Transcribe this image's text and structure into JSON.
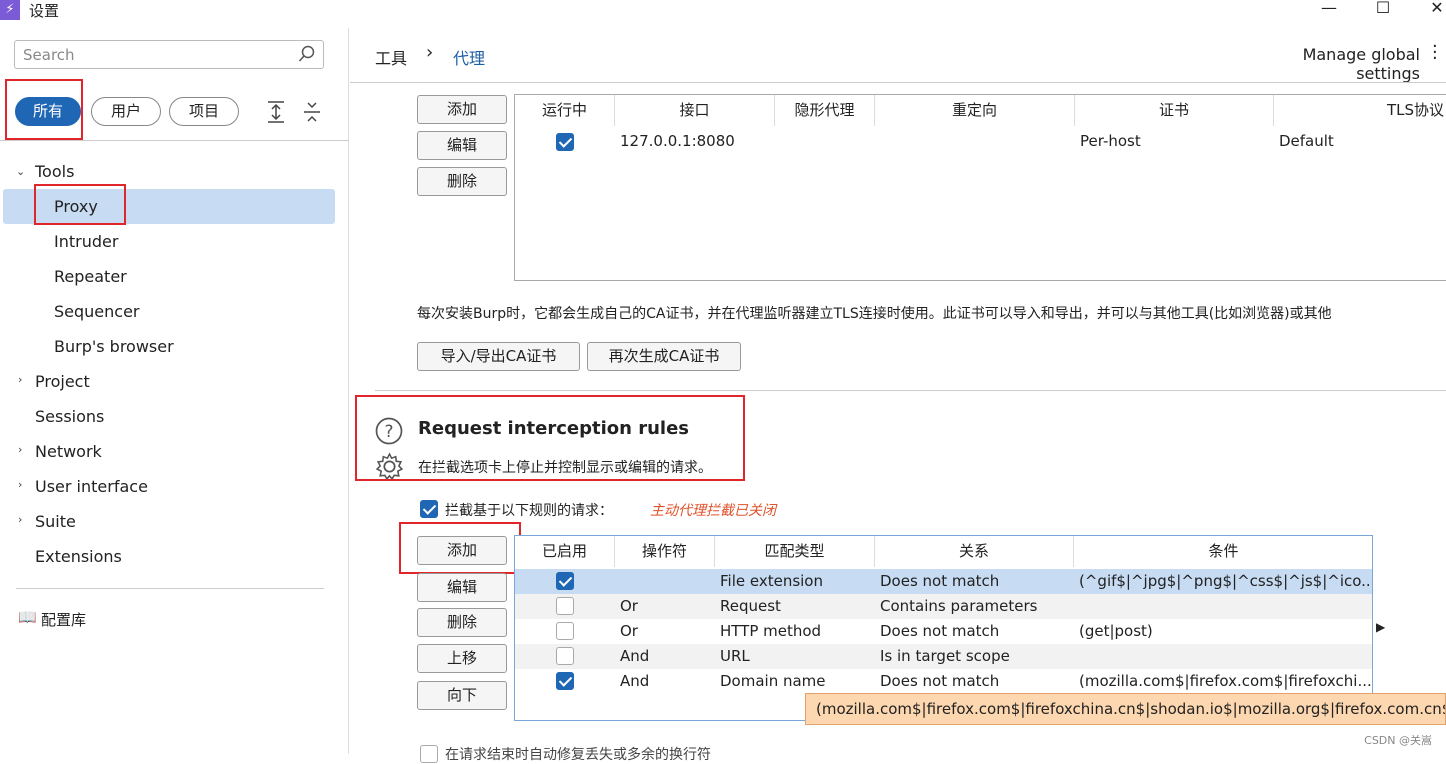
{
  "window": {
    "title": "设置",
    "logo": "⚡"
  },
  "sidebar": {
    "search_placeholder": "Search",
    "filters": [
      "所有",
      "用户",
      "项目"
    ],
    "tree": {
      "tools": "Tools",
      "proxy": "Proxy",
      "intruder": "Intruder",
      "repeater": "Repeater",
      "sequencer": "Sequencer",
      "burp_browser": "Burp's browser",
      "project": "Project",
      "sessions": "Sessions",
      "network": "Network",
      "user_interface": "User interface",
      "suite": "Suite",
      "extensions": "Extensions"
    },
    "library": "配置库"
  },
  "header": {
    "crumb_tools": "工具",
    "crumb_sep": "›",
    "crumb_proxy": "代理",
    "manage": "Manage global settings"
  },
  "listeners": {
    "buttons": {
      "add": "添加",
      "edit": "编辑",
      "remove": "删除"
    },
    "columns": [
      "运行中",
      "接口",
      "隐形代理",
      "重定向",
      "证书",
      "TLS协议"
    ],
    "rows": [
      {
        "running": true,
        "interface": "127.0.0.1:8080",
        "invisible": "",
        "redirect": "",
        "cert": "Per-host",
        "tls": "Default"
      }
    ]
  },
  "ca": {
    "text": "每次安装Burp时，它都会生成自己的CA证书，并在代理监听器建立TLS连接时使用。此证书可以导入和导出，并可以与其他工具(比如浏览器)或其他",
    "import_export": "导入/导出CA证书",
    "regenerate": "再次生成CA证书"
  },
  "interception": {
    "title": "Request interception rules",
    "desc": "在拦截选项卡上停止并控制显示或编辑的请求。",
    "intercept_label": "拦截基于以下规则的请求：",
    "status": "主动代理拦截已关闭",
    "buttons": {
      "add": "添加",
      "edit": "编辑",
      "remove": "删除",
      "up": "上移",
      "down": "向下"
    },
    "columns": [
      "已启用",
      "操作符",
      "匹配类型",
      "关系",
      "条件"
    ],
    "rows": [
      {
        "enabled": true,
        "op": "",
        "match": "File extension",
        "rel": "Does not match",
        "cond": "(^gif$|^jpg$|^png$|^css$|^js$|^ico..."
      },
      {
        "enabled": false,
        "op": "Or",
        "match": "Request",
        "rel": "Contains parameters",
        "cond": ""
      },
      {
        "enabled": false,
        "op": "Or",
        "match": "HTTP method",
        "rel": "Does not match",
        "cond": "(get|post)"
      },
      {
        "enabled": false,
        "op": "And",
        "match": "URL",
        "rel": "Is in target scope",
        "cond": ""
      },
      {
        "enabled": true,
        "op": "And",
        "match": "Domain name",
        "rel": "Does not match",
        "cond": "(mozilla.com$|firefox.com$|firefoxchi..."
      }
    ],
    "tooltip": "(mozilla.com$|firefox.com$|firefoxchina.cn$|shodan.io$|mozilla.org$|firefox.com.cn$",
    "bottom_option": "在请求结束时自动修复丢失或多余的换行符"
  },
  "watermark": "CSDN @关嵩"
}
